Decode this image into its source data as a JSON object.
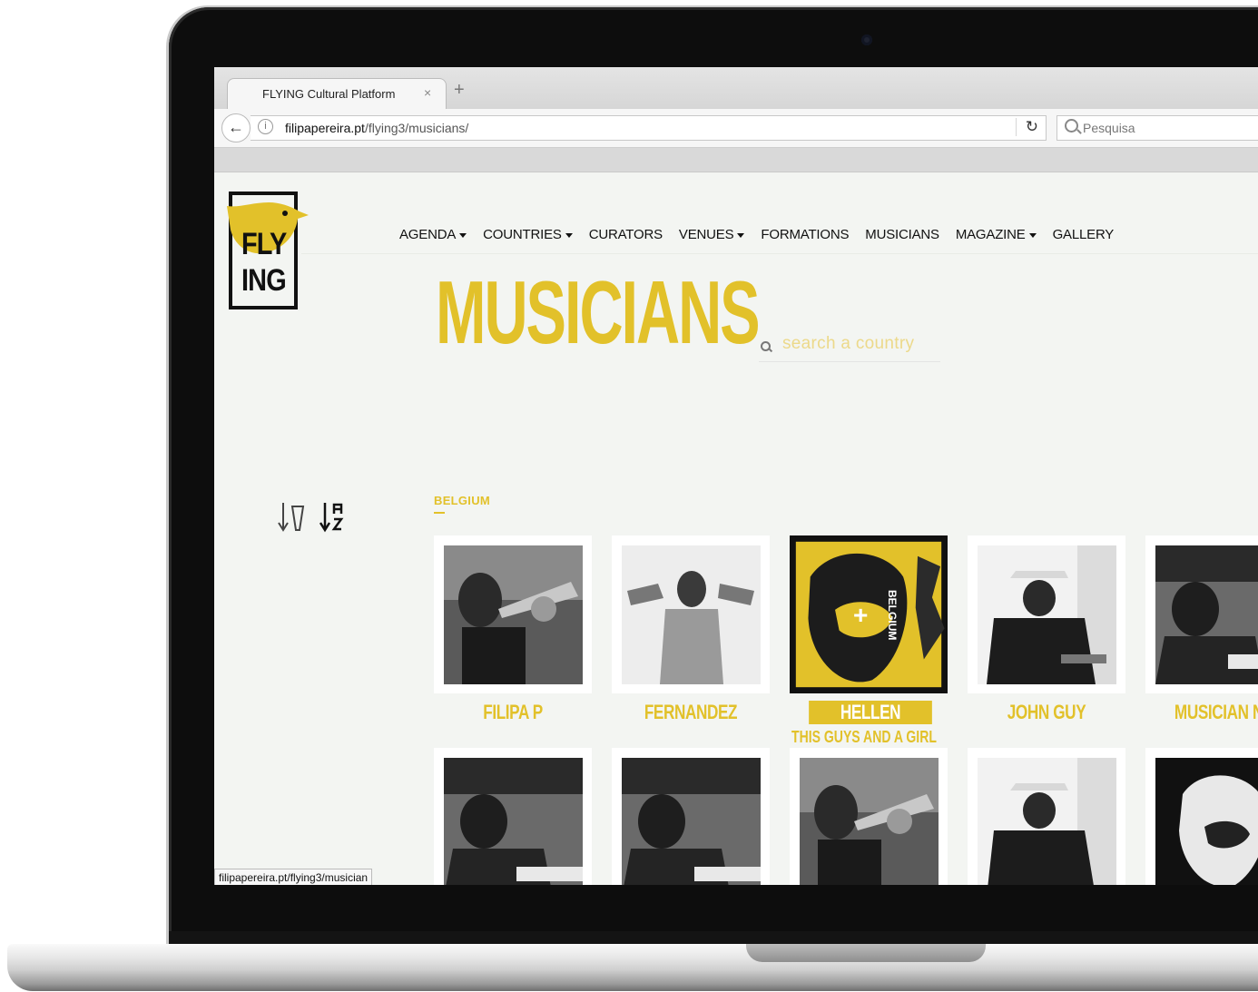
{
  "browser": {
    "tab_title": "FLYING Cultural Platform",
    "tab_close": "×",
    "new_tab": "+",
    "url_host": "filipapereira.pt",
    "url_path": "/flying3/musicians/",
    "search_placeholder": "Pesquisa",
    "status_url": "filipapereira.pt/flying3/musician"
  },
  "logo": {
    "line1": "FLY",
    "line2": "ING"
  },
  "nav": [
    {
      "label": "AGENDA",
      "dropdown": true
    },
    {
      "label": "COUNTRIES",
      "dropdown": true
    },
    {
      "label": "CURATORS",
      "dropdown": false
    },
    {
      "label": "VENUES",
      "dropdown": true
    },
    {
      "label": "FORMATIONS",
      "dropdown": false
    },
    {
      "label": "MUSICIANS",
      "dropdown": false
    },
    {
      "label": "MAGAZINE",
      "dropdown": true
    },
    {
      "label": "GALLERY",
      "dropdown": false
    }
  ],
  "page": {
    "title": "MUSICIANS",
    "country_search_placeholder": "search a country",
    "section": "BELGIUM"
  },
  "musicians": [
    {
      "name": "FILIPA P",
      "photo": "trumpeter"
    },
    {
      "name": "FERNANDEZ",
      "photo": "two-trumpets"
    },
    {
      "name": "HELLEN",
      "subtitle": "THIS GUYS AND A GIRL",
      "photo": "singer",
      "active": true,
      "overlay_text": "BELGIUM",
      "overlay_icon": "plus-icon"
    },
    {
      "name": "JOHN GUY",
      "photo": "pianist-hat"
    },
    {
      "name": "MUSICIAN NA",
      "photo": "pianist"
    },
    {
      "name": "",
      "photo": "pianist"
    },
    {
      "name": "",
      "photo": "pianist"
    },
    {
      "name": "",
      "photo": "trumpeter"
    },
    {
      "name": "",
      "photo": "pianist-hat"
    },
    {
      "name": "",
      "photo": "singer"
    }
  ],
  "colors": {
    "accent": "#e2c12a",
    "page_bg": "#f3f5f2",
    "text": "#111111"
  },
  "icons": [
    "back-arrow-icon",
    "info-icon",
    "reload-icon",
    "search-icon",
    "sort-by-time-icon",
    "sort-a-z-icon",
    "plus-icon"
  ]
}
